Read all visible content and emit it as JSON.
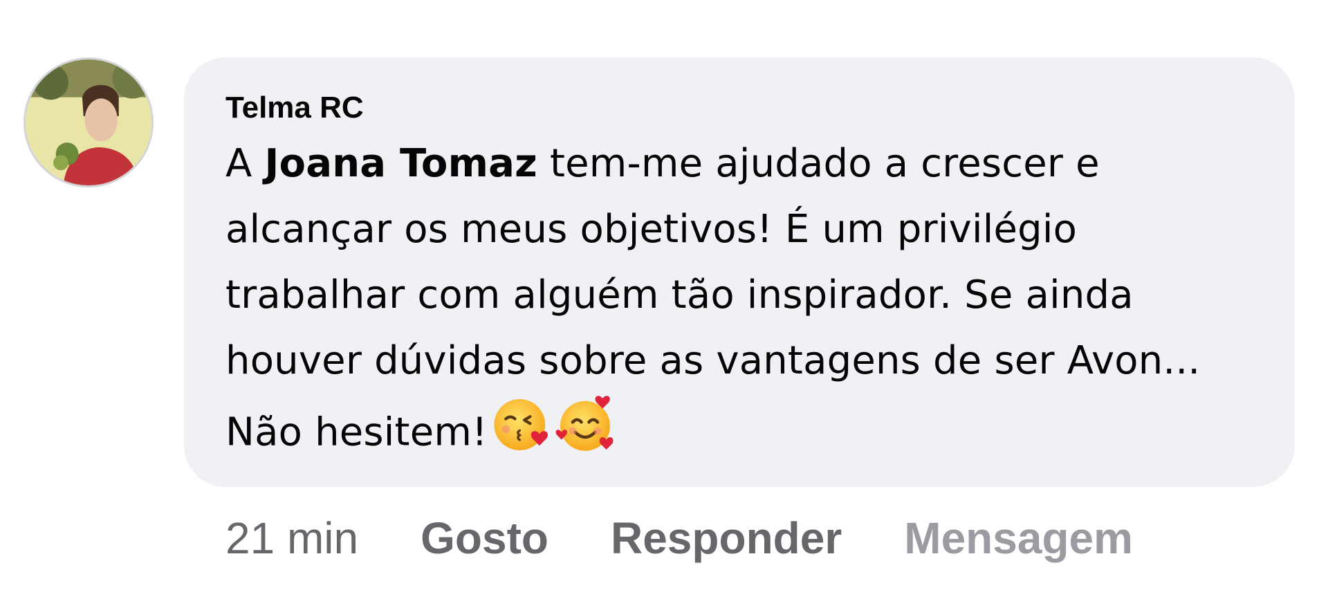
{
  "comment": {
    "author": "Telma RC",
    "text_prefix": "A ",
    "mention": "Joana Tomaz",
    "text_body": " tem-me ajudado a crescer e alcançar os meus objetivos! É um privilégio trabalhar com alguém tão inspirador. Se ainda houver dúvidas sobre as vantagens de ser Avon... Não hesitem!",
    "emojis": [
      "kissing-face-with-heart-icon",
      "smiling-face-with-hearts-icon"
    ]
  },
  "actions": {
    "time": "21 min",
    "like_label": "Gosto",
    "reply_label": "Responder",
    "message_label": "Mensagem"
  },
  "colors": {
    "bubble_bg": "#f0f1f4",
    "text": "#050505",
    "meta": "#65676b",
    "meta_light": "#9a9ca1"
  }
}
